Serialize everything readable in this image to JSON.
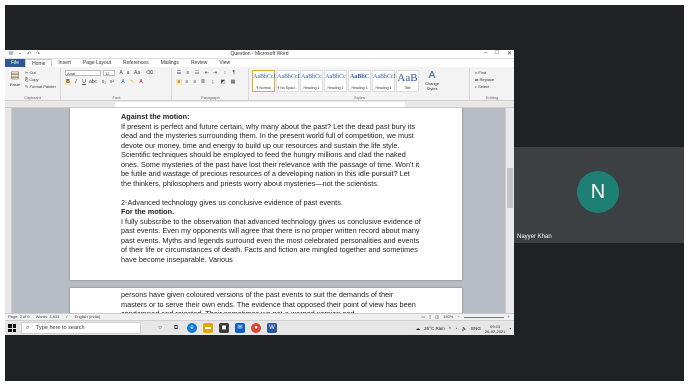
{
  "word": {
    "window_title": "Question - Microsoft Word",
    "window_controls": [
      "–",
      "□",
      "✕"
    ],
    "quick_access": [
      "save-icon",
      "undo-icon",
      "redo-icon"
    ],
    "tabs": [
      {
        "label": "File"
      },
      {
        "label": "Home"
      },
      {
        "label": "Insert"
      },
      {
        "label": "Page Layout"
      },
      {
        "label": "References"
      },
      {
        "label": "Mailings"
      },
      {
        "label": "Review"
      },
      {
        "label": "View"
      }
    ],
    "ribbon": {
      "clipboard": {
        "paste": "Paste",
        "cut": "Cut",
        "copy": "Copy",
        "format_painter": "Format Painter",
        "label": "Clipboard"
      },
      "font": {
        "name": "Arial",
        "size": "12",
        "label": "Font"
      },
      "paragraph": {
        "label": "Paragraph"
      },
      "styles": {
        "label": "Styles",
        "items": [
          {
            "sample": "AaBbCcDc",
            "name": "¶ Normal"
          },
          {
            "sample": "AaBbCcDc",
            "name": "¶ No Spaci..."
          },
          {
            "sample": "AaBbCc",
            "name": "Heading 1"
          },
          {
            "sample": "AaBbCc",
            "name": "Heading 2"
          },
          {
            "sample": "AaBbC",
            "name": "Heading 3"
          },
          {
            "sample": "AaBbCcI",
            "name": "Heading 4"
          },
          {
            "sample": "AaB",
            "name": "Title"
          }
        ],
        "change_styles": "Change Styles"
      },
      "editing": {
        "find": "Find",
        "replace": "Replace",
        "select": "Select",
        "label": "Editing"
      }
    },
    "document": {
      "page1": [
        {
          "bold": "Against the motion:",
          "text": ""
        },
        {
          "bold": "",
          "text": "If present is perfect and future certain, why many about the past? Let the dead past bury its dead and the mysteries surrounding them. In the present world full of competition, we must devote our money, time and energy to build up our resources and sustain the life style. Scientific techniques should be employed to feed the hungry millions and clad the naked ones. Some mysteries of the past have lost their relevance with the passage of time. Won't it be futile and wastage of precious resources of a developing nation in this idle pursuit? Let the thinkers, philosophers and priests worry about mysteries—not the scientists."
        },
        {
          "bold": "",
          "text": "2-Advanced technology gives us conclusive evidence of past events."
        },
        {
          "bold": "For the motion.",
          "text": ""
        },
        {
          "bold": "",
          "text": "I fully subscribe to the observation that advanced technology gives us conclusive evidence of past events. Even my opponents will agree that there is no proper written record about many past events. Myths and legends surround even the most celebrated personalities and events of their life or circumstances of death. Facts and fiction are mingled together and sometimes have become inseparable. Various"
        }
      ],
      "page2": "persons have given coloured versions of the past events to suit the demands of their masters or to serve their own ends. The evidence that opposed their point of view has been condemned and rejected. Their sometimes we get a warped version and"
    },
    "status": {
      "page": "Page: 2 of 9",
      "words": "Words: 3,833",
      "language": "English (India)",
      "zoom": "150%"
    }
  },
  "taskbar": {
    "search_placeholder": "Type here to search",
    "weather": "26°C  Rain",
    "language": "ENG",
    "time": "09:13",
    "date": "26-07-2021"
  },
  "meet": {
    "participant_initial": "N",
    "participant_name": "Nayyer Khan",
    "avatar_color": "#1e8074"
  }
}
